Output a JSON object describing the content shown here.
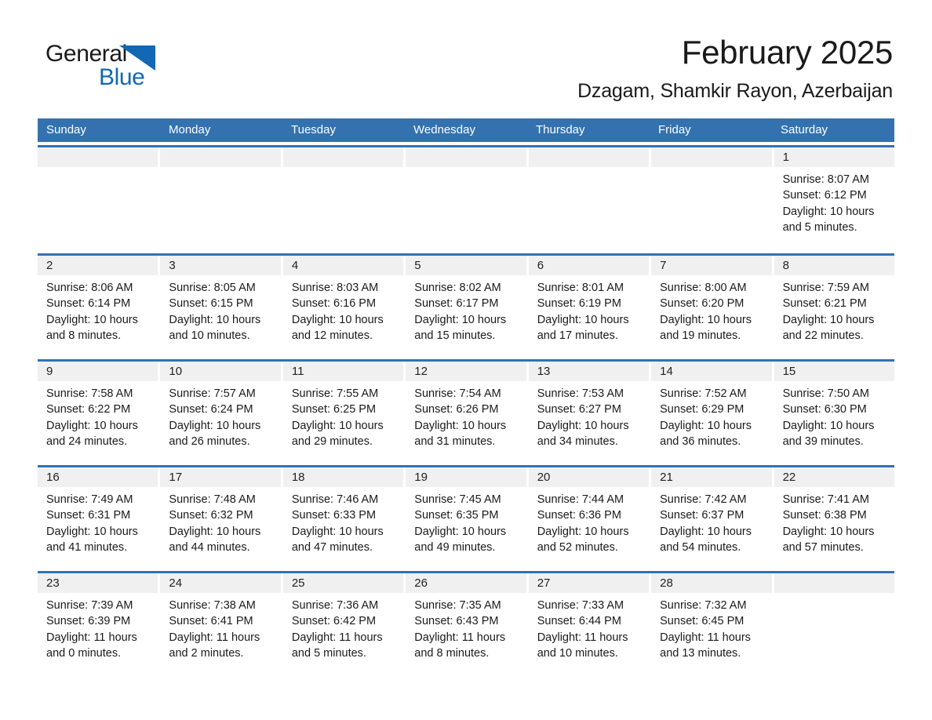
{
  "brand": {
    "name_primary": "General",
    "name_secondary": "Blue",
    "triangle_color": "#1268B3"
  },
  "header": {
    "title": "February 2025",
    "subtitle": "Dzagam, Shamkir Rayon, Azerbaijan",
    "accent_color": "#3372AF",
    "band_color": "#f0f0f0"
  },
  "weekdays": [
    "Sunday",
    "Monday",
    "Tuesday",
    "Wednesday",
    "Thursday",
    "Friday",
    "Saturday"
  ],
  "labels": {
    "sunrise_prefix": "Sunrise:",
    "sunset_prefix": "Sunset:",
    "daylight_prefix": "Daylight:"
  },
  "weeks": [
    [
      {
        "day": "",
        "sunrise": "",
        "sunset": "",
        "daylight_line1": "",
        "daylight_line2": ""
      },
      {
        "day": "",
        "sunrise": "",
        "sunset": "",
        "daylight_line1": "",
        "daylight_line2": ""
      },
      {
        "day": "",
        "sunrise": "",
        "sunset": "",
        "daylight_line1": "",
        "daylight_line2": ""
      },
      {
        "day": "",
        "sunrise": "",
        "sunset": "",
        "daylight_line1": "",
        "daylight_line2": ""
      },
      {
        "day": "",
        "sunrise": "",
        "sunset": "",
        "daylight_line1": "",
        "daylight_line2": ""
      },
      {
        "day": "",
        "sunrise": "",
        "sunset": "",
        "daylight_line1": "",
        "daylight_line2": ""
      },
      {
        "day": "1",
        "sunrise": "Sunrise: 8:07 AM",
        "sunset": "Sunset: 6:12 PM",
        "daylight_line1": "Daylight: 10 hours",
        "daylight_line2": "and 5 minutes."
      }
    ],
    [
      {
        "day": "2",
        "sunrise": "Sunrise: 8:06 AM",
        "sunset": "Sunset: 6:14 PM",
        "daylight_line1": "Daylight: 10 hours",
        "daylight_line2": "and 8 minutes."
      },
      {
        "day": "3",
        "sunrise": "Sunrise: 8:05 AM",
        "sunset": "Sunset: 6:15 PM",
        "daylight_line1": "Daylight: 10 hours",
        "daylight_line2": "and 10 minutes."
      },
      {
        "day": "4",
        "sunrise": "Sunrise: 8:03 AM",
        "sunset": "Sunset: 6:16 PM",
        "daylight_line1": "Daylight: 10 hours",
        "daylight_line2": "and 12 minutes."
      },
      {
        "day": "5",
        "sunrise": "Sunrise: 8:02 AM",
        "sunset": "Sunset: 6:17 PM",
        "daylight_line1": "Daylight: 10 hours",
        "daylight_line2": "and 15 minutes."
      },
      {
        "day": "6",
        "sunrise": "Sunrise: 8:01 AM",
        "sunset": "Sunset: 6:19 PM",
        "daylight_line1": "Daylight: 10 hours",
        "daylight_line2": "and 17 minutes."
      },
      {
        "day": "7",
        "sunrise": "Sunrise: 8:00 AM",
        "sunset": "Sunset: 6:20 PM",
        "daylight_line1": "Daylight: 10 hours",
        "daylight_line2": "and 19 minutes."
      },
      {
        "day": "8",
        "sunrise": "Sunrise: 7:59 AM",
        "sunset": "Sunset: 6:21 PM",
        "daylight_line1": "Daylight: 10 hours",
        "daylight_line2": "and 22 minutes."
      }
    ],
    [
      {
        "day": "9",
        "sunrise": "Sunrise: 7:58 AM",
        "sunset": "Sunset: 6:22 PM",
        "daylight_line1": "Daylight: 10 hours",
        "daylight_line2": "and 24 minutes."
      },
      {
        "day": "10",
        "sunrise": "Sunrise: 7:57 AM",
        "sunset": "Sunset: 6:24 PM",
        "daylight_line1": "Daylight: 10 hours",
        "daylight_line2": "and 26 minutes."
      },
      {
        "day": "11",
        "sunrise": "Sunrise: 7:55 AM",
        "sunset": "Sunset: 6:25 PM",
        "daylight_line1": "Daylight: 10 hours",
        "daylight_line2": "and 29 minutes."
      },
      {
        "day": "12",
        "sunrise": "Sunrise: 7:54 AM",
        "sunset": "Sunset: 6:26 PM",
        "daylight_line1": "Daylight: 10 hours",
        "daylight_line2": "and 31 minutes."
      },
      {
        "day": "13",
        "sunrise": "Sunrise: 7:53 AM",
        "sunset": "Sunset: 6:27 PM",
        "daylight_line1": "Daylight: 10 hours",
        "daylight_line2": "and 34 minutes."
      },
      {
        "day": "14",
        "sunrise": "Sunrise: 7:52 AM",
        "sunset": "Sunset: 6:29 PM",
        "daylight_line1": "Daylight: 10 hours",
        "daylight_line2": "and 36 minutes."
      },
      {
        "day": "15",
        "sunrise": "Sunrise: 7:50 AM",
        "sunset": "Sunset: 6:30 PM",
        "daylight_line1": "Daylight: 10 hours",
        "daylight_line2": "and 39 minutes."
      }
    ],
    [
      {
        "day": "16",
        "sunrise": "Sunrise: 7:49 AM",
        "sunset": "Sunset: 6:31 PM",
        "daylight_line1": "Daylight: 10 hours",
        "daylight_line2": "and 41 minutes."
      },
      {
        "day": "17",
        "sunrise": "Sunrise: 7:48 AM",
        "sunset": "Sunset: 6:32 PM",
        "daylight_line1": "Daylight: 10 hours",
        "daylight_line2": "and 44 minutes."
      },
      {
        "day": "18",
        "sunrise": "Sunrise: 7:46 AM",
        "sunset": "Sunset: 6:33 PM",
        "daylight_line1": "Daylight: 10 hours",
        "daylight_line2": "and 47 minutes."
      },
      {
        "day": "19",
        "sunrise": "Sunrise: 7:45 AM",
        "sunset": "Sunset: 6:35 PM",
        "daylight_line1": "Daylight: 10 hours",
        "daylight_line2": "and 49 minutes."
      },
      {
        "day": "20",
        "sunrise": "Sunrise: 7:44 AM",
        "sunset": "Sunset: 6:36 PM",
        "daylight_line1": "Daylight: 10 hours",
        "daylight_line2": "and 52 minutes."
      },
      {
        "day": "21",
        "sunrise": "Sunrise: 7:42 AM",
        "sunset": "Sunset: 6:37 PM",
        "daylight_line1": "Daylight: 10 hours",
        "daylight_line2": "and 54 minutes."
      },
      {
        "day": "22",
        "sunrise": "Sunrise: 7:41 AM",
        "sunset": "Sunset: 6:38 PM",
        "daylight_line1": "Daylight: 10 hours",
        "daylight_line2": "and 57 minutes."
      }
    ],
    [
      {
        "day": "23",
        "sunrise": "Sunrise: 7:39 AM",
        "sunset": "Sunset: 6:39 PM",
        "daylight_line1": "Daylight: 11 hours",
        "daylight_line2": "and 0 minutes."
      },
      {
        "day": "24",
        "sunrise": "Sunrise: 7:38 AM",
        "sunset": "Sunset: 6:41 PM",
        "daylight_line1": "Daylight: 11 hours",
        "daylight_line2": "and 2 minutes."
      },
      {
        "day": "25",
        "sunrise": "Sunrise: 7:36 AM",
        "sunset": "Sunset: 6:42 PM",
        "daylight_line1": "Daylight: 11 hours",
        "daylight_line2": "and 5 minutes."
      },
      {
        "day": "26",
        "sunrise": "Sunrise: 7:35 AM",
        "sunset": "Sunset: 6:43 PM",
        "daylight_line1": "Daylight: 11 hours",
        "daylight_line2": "and 8 minutes."
      },
      {
        "day": "27",
        "sunrise": "Sunrise: 7:33 AM",
        "sunset": "Sunset: 6:44 PM",
        "daylight_line1": "Daylight: 11 hours",
        "daylight_line2": "and 10 minutes."
      },
      {
        "day": "28",
        "sunrise": "Sunrise: 7:32 AM",
        "sunset": "Sunset: 6:45 PM",
        "daylight_line1": "Daylight: 11 hours",
        "daylight_line2": "and 13 minutes."
      },
      {
        "day": "",
        "sunrise": "",
        "sunset": "",
        "daylight_line1": "",
        "daylight_line2": ""
      }
    ]
  ]
}
